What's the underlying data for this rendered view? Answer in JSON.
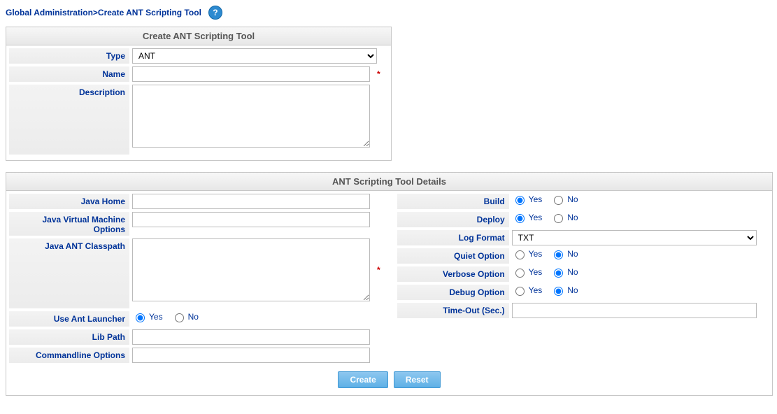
{
  "breadcrumb": "Global Administration>Create ANT Scripting Tool",
  "panel1": {
    "title": "Create ANT Scripting Tool",
    "labels": {
      "type": "Type",
      "name": "Name",
      "description": "Description"
    },
    "values": {
      "type": "ANT",
      "name": "",
      "description": ""
    }
  },
  "panel2": {
    "title": "ANT Scripting Tool Details",
    "left": {
      "java_home": {
        "label": "Java Home",
        "value": ""
      },
      "jvm_options": {
        "label": "Java Virtual Machine Options",
        "value": ""
      },
      "ant_classpath": {
        "label": "Java ANT Classpath",
        "value": ""
      },
      "use_ant_launcher": {
        "label": "Use Ant Launcher",
        "yes": "Yes",
        "no": "No",
        "selected": "yes"
      },
      "lib_path": {
        "label": "Lib Path",
        "value": ""
      },
      "cmd_options": {
        "label": "Commandline Options",
        "value": ""
      }
    },
    "right": {
      "build": {
        "label": "Build",
        "yes": "Yes",
        "no": "No",
        "selected": "yes"
      },
      "deploy": {
        "label": "Deploy",
        "yes": "Yes",
        "no": "No",
        "selected": "yes"
      },
      "log_format": {
        "label": "Log Format",
        "value": "TXT"
      },
      "quiet": {
        "label": "Quiet Option",
        "yes": "Yes",
        "no": "No",
        "selected": "no"
      },
      "verbose": {
        "label": "Verbose Option",
        "yes": "Yes",
        "no": "No",
        "selected": "no"
      },
      "debug": {
        "label": "Debug Option",
        "yes": "Yes",
        "no": "No",
        "selected": "no"
      },
      "timeout": {
        "label": "Time-Out (Sec.)",
        "value": ""
      }
    }
  },
  "buttons": {
    "create": "Create",
    "reset": "Reset"
  },
  "common": {
    "required": "*"
  }
}
